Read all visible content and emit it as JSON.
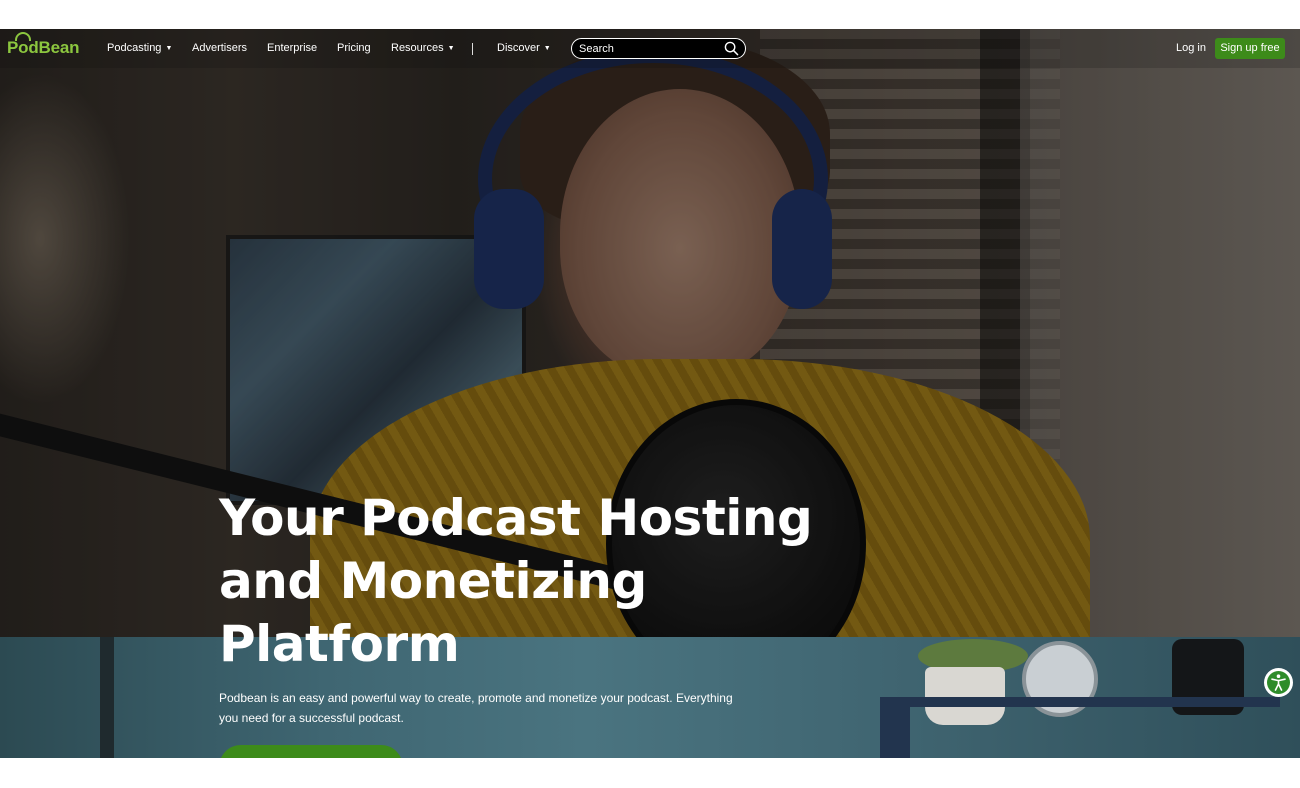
{
  "brand": {
    "name": "PodBean",
    "color": "#8cc63f"
  },
  "nav": {
    "items": [
      {
        "label": "Podcasting",
        "dropdown": true
      },
      {
        "label": "Advertisers",
        "dropdown": false
      },
      {
        "label": "Enterprise",
        "dropdown": false
      },
      {
        "label": "Pricing",
        "dropdown": false
      },
      {
        "label": "Resources",
        "dropdown": true
      },
      {
        "label": "Discover",
        "dropdown": true
      }
    ],
    "search": {
      "placeholder": "Search",
      "icon": "search-icon"
    },
    "login_label": "Log in",
    "signup_label": "Sign up free"
  },
  "hero": {
    "headline_lines": [
      "Your Podcast Hosting",
      "and Monetizing",
      "Platform"
    ],
    "subcopy": "Podbean is an easy and powerful way to create, promote and monetize your podcast. Everything you need for a successful podcast."
  },
  "accessibility": {
    "icon": "accessibility-icon",
    "color": "#2e8c2a"
  },
  "colors": {
    "accent": "#3d8b1a",
    "nav_text": "#ffffff"
  }
}
